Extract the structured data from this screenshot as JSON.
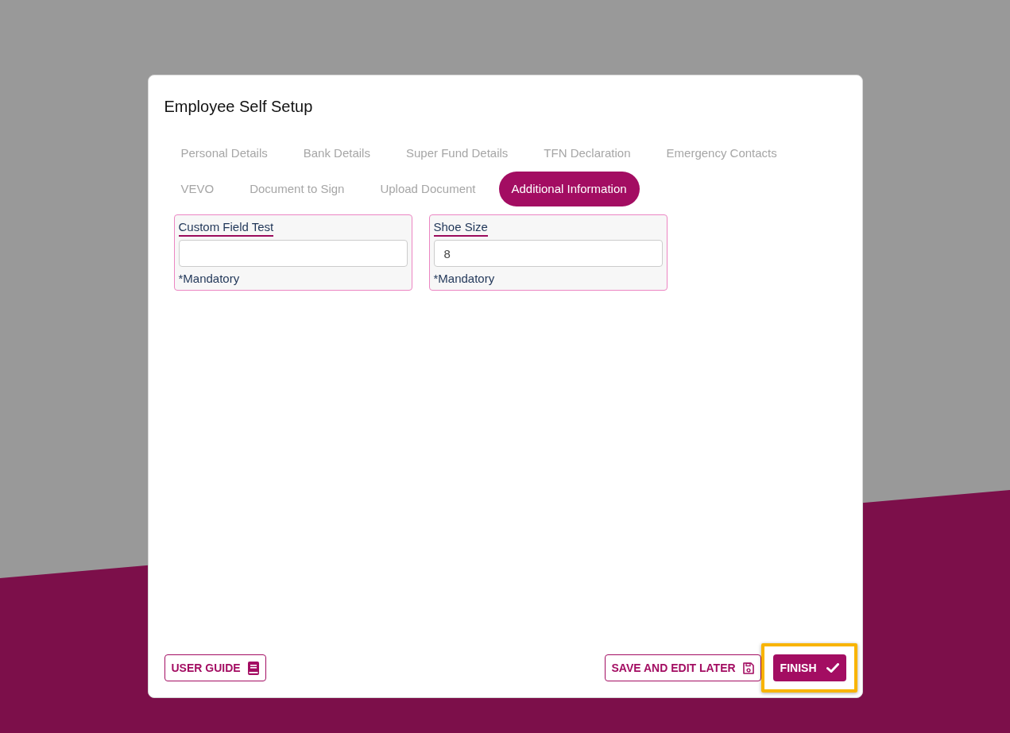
{
  "dialog": {
    "title": "Employee Self Setup"
  },
  "tabs": [
    {
      "label": "Personal Details",
      "selected": false
    },
    {
      "label": "Bank Details",
      "selected": false
    },
    {
      "label": "Super Fund Details",
      "selected": false
    },
    {
      "label": "TFN Declaration",
      "selected": false
    },
    {
      "label": "Emergency Contacts",
      "selected": false
    },
    {
      "label": "VEVO",
      "selected": false
    },
    {
      "label": "Document to Sign",
      "selected": false
    },
    {
      "label": "Upload Document",
      "selected": false
    },
    {
      "label": "Additional Information",
      "selected": true
    }
  ],
  "fields": [
    {
      "label": "Custom Field Test",
      "note": "*Mandatory"
    },
    {
      "label": "Shoe Size",
      "value": "8",
      "note": "*Mandatory"
    }
  ],
  "footer": {
    "user_guide": "USER GUIDE",
    "save_and_edit_later": "SAVE AND EDIT LATER",
    "finish": {
      "label": "FINISH",
      "highlighted": true
    }
  }
}
